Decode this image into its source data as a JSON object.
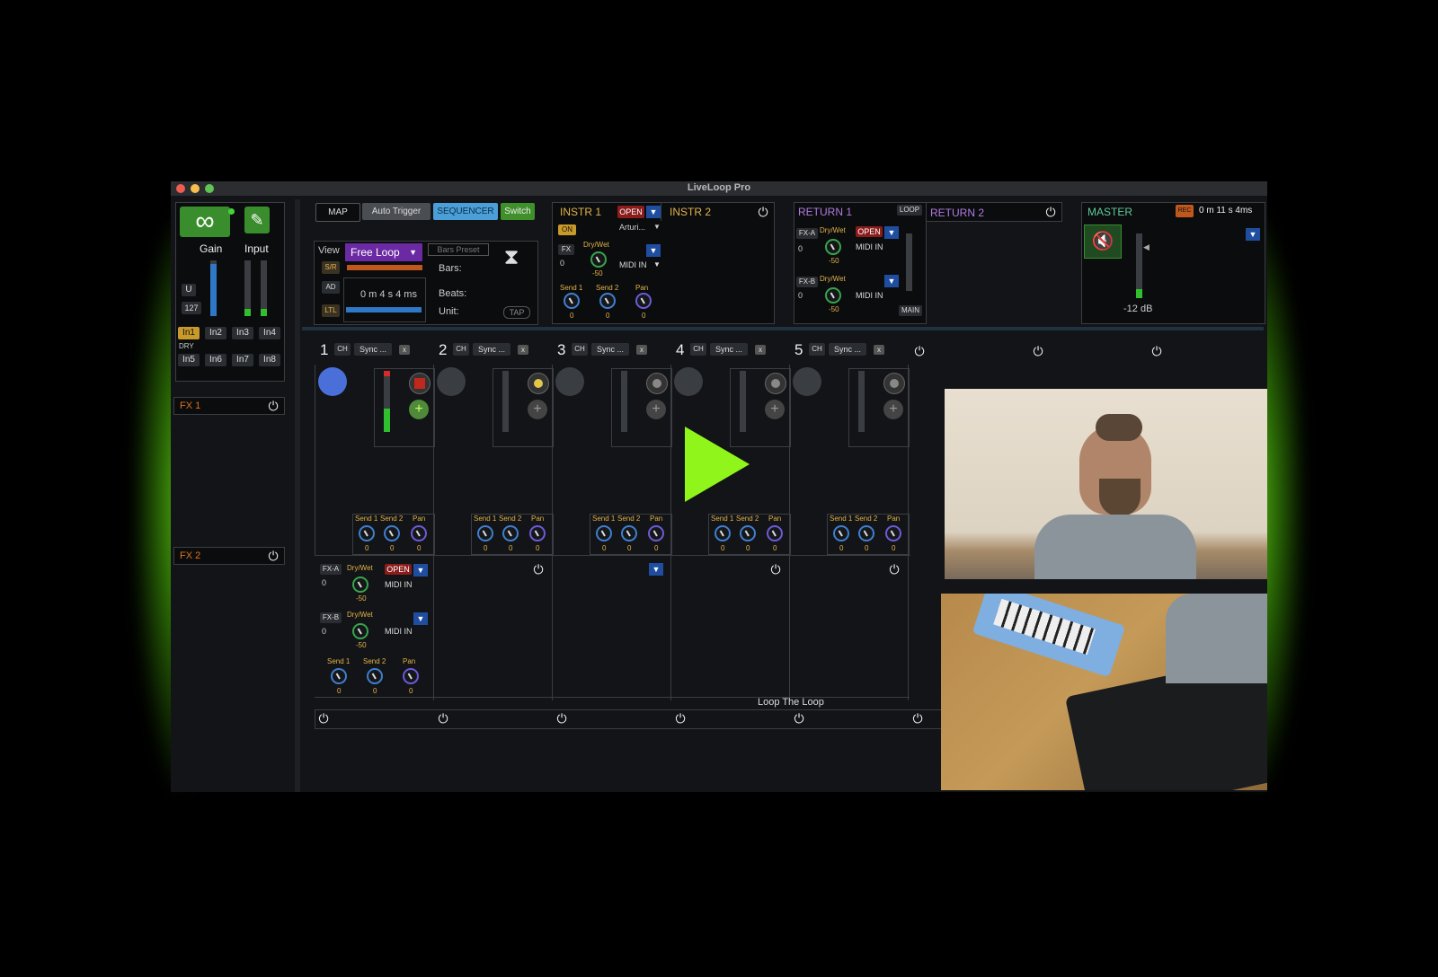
{
  "window": {
    "title": "LiveLoop Pro"
  },
  "left_panel": {
    "gain_label": "Gain",
    "input_label": "Input",
    "u_label": "U",
    "value_127": "127",
    "inputs_row1": [
      "In1",
      "In2",
      "In3",
      "In4"
    ],
    "dry_label": "DRY",
    "inputs_row2": [
      "In5",
      "In6",
      "In7",
      "In8"
    ],
    "fx1_label": "FX 1",
    "fx2_label": "FX 2"
  },
  "toolbar": {
    "map": "MAP",
    "auto_trigger": "Auto Trigger",
    "sequencer": "SEQUENCER",
    "switch": "Switch",
    "view": "View",
    "free_loop": "Free Loop",
    "bars_preset": "Bars Preset",
    "bars_label": "Bars:",
    "beats_label": "Beats:",
    "unit_label": "Unit:",
    "sr": "S/R",
    "ad": "AD",
    "ltl": "LTL",
    "time": "0 m  4  s 4 ms",
    "tap": "TAP"
  },
  "instr1": {
    "label": "INSTR 1",
    "open": "OPEN",
    "on": "ON",
    "preset": "Arturi...",
    "fx": "FX",
    "fx_val": "0",
    "drywet": "Dry/Wet",
    "drywet_val": "-50",
    "midi_in": "MIDI IN",
    "send1": "Send 1",
    "send2": "Send 2",
    "pan": "Pan",
    "send1_val": "0",
    "send2_val": "0",
    "pan_val": "0"
  },
  "instr2": {
    "label": "INSTR 2"
  },
  "return1": {
    "label": "RETURN 1",
    "loop": "LOOP",
    "fxa": "FX-A",
    "fxa_val": "0",
    "fxb": "FX-B",
    "fxb_val": "0",
    "drywet": "Dry/Wet",
    "open": "OPEN",
    "midi_in": "MIDI IN",
    "val_a": "-50",
    "val_b": "-50",
    "main": "MAIN"
  },
  "return2": {
    "label": "RETURN 2"
  },
  "master": {
    "label": "MASTER",
    "rec": "REC",
    "time": "0   m 11 s 4ms",
    "db": "-12 dB"
  },
  "tracks": [
    {
      "num": "1",
      "ch": "CH",
      "sync": "Sync ...",
      "x": "x"
    },
    {
      "num": "2",
      "ch": "CH",
      "sync": "Sync ...",
      "x": "x"
    },
    {
      "num": "3",
      "ch": "CH",
      "sync": "Sync ...",
      "x": "x"
    },
    {
      "num": "4",
      "ch": "CH",
      "sync": "Sync ...",
      "x": "x"
    },
    {
      "num": "5",
      "ch": "CH",
      "sync": "Sync ...",
      "x": "x"
    }
  ],
  "track_knobs": {
    "send1": "Send 1",
    "send2": "Send 2",
    "pan": "Pan",
    "zero": "0"
  },
  "track_fx": {
    "fxa": "FX-A",
    "fxb": "FX-B",
    "zero": "0",
    "drywet": "Dry/Wet",
    "open": "OPEN",
    "midi_in": "MIDI IN",
    "minus50": "-50",
    "send1": "Send 1",
    "send2": "Send 2",
    "pan": "Pan"
  },
  "loop_the_loop": "Loop The Loop",
  "colors": {
    "accent_green": "#8ff51a",
    "accent_blue": "#4a9fd8",
    "rec_red": "#c0281d"
  }
}
